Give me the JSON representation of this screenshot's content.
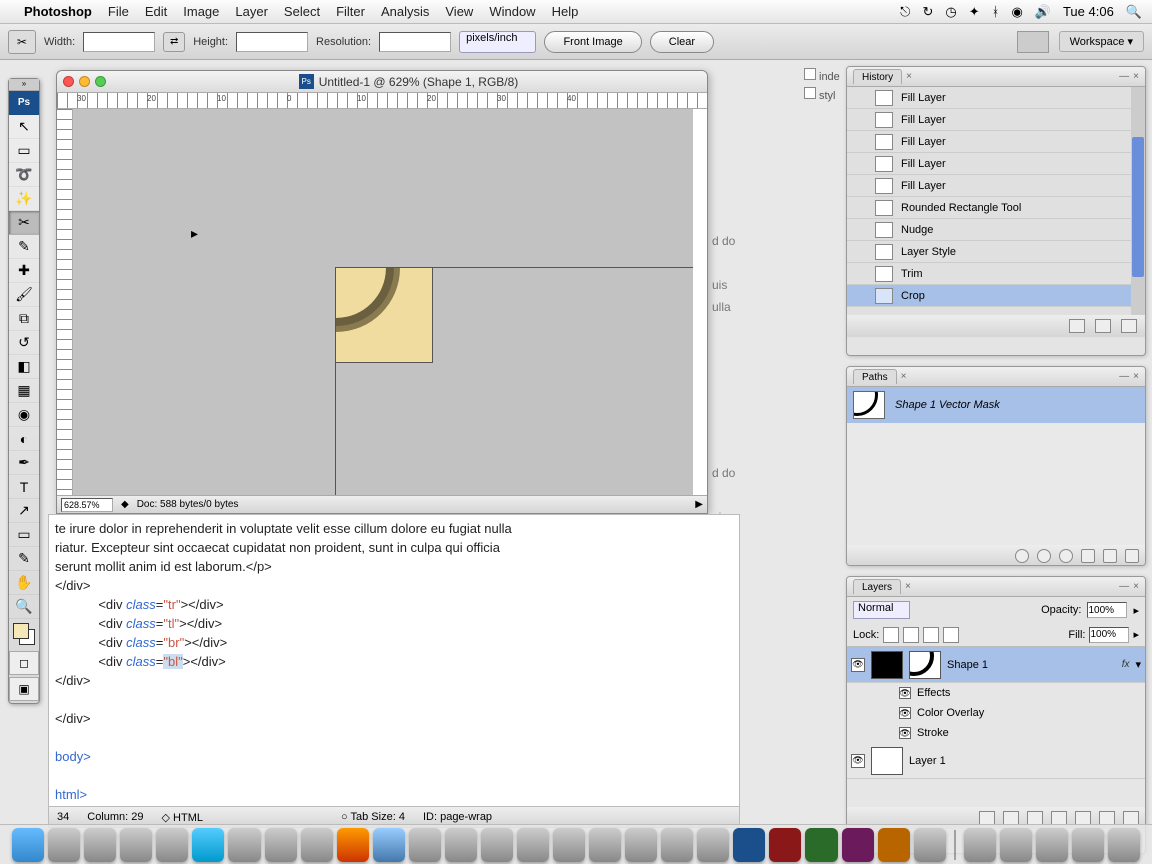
{
  "menubar": {
    "app": "Photoshop",
    "items": [
      "File",
      "Edit",
      "Image",
      "Layer",
      "Select",
      "Filter",
      "Analysis",
      "View",
      "Window",
      "Help"
    ],
    "clock": "Tue 4:06"
  },
  "options": {
    "width_label": "Width:",
    "height_label": "Height:",
    "resolution_label": "Resolution:",
    "unit": "pixels/inch",
    "front_image": "Front Image",
    "clear": "Clear",
    "workspace": "Workspace"
  },
  "document": {
    "title": "Untitled-1 @ 629% (Shape 1, RGB/8)",
    "zoom": "628.57%",
    "docinfo": "Doc: 588 bytes/0 bytes",
    "ruler_marks": [
      "30",
      "20",
      "10",
      "0",
      "10",
      "20",
      "30",
      "40"
    ]
  },
  "code": {
    "lines": [
      "te irure dolor in reprehenderit in voluptate velit esse cillum dolore eu fugiat nulla",
      "riatur. Excepteur sint occaecat cupidatat non proident, sunt in culpa qui officia",
      "serunt mollit anim id est laborum.</p>",
      "            </div>",
      "            <div class=\"tr\"></div>",
      "            <div class=\"tl\"></div>",
      "            <div class=\"br\"></div>",
      "            <div class=\"bl\"></div>",
      "    </div>",
      "",
      "  </div>",
      "",
      "body>",
      "",
      "html>"
    ],
    "status_line": "34",
    "status_col_label": "Column:",
    "status_col": "29",
    "status_lang": "HTML",
    "status_tabsize_label": "Tab Size:",
    "status_tabsize": "4",
    "status_id_label": "ID:",
    "status_id": "page-wrap"
  },
  "files": {
    "a": "inde",
    "b": "styl"
  },
  "underlay": {
    "a": "d do",
    "b": "uis",
    "c": "ulla",
    "a2": "d do",
    "b2": "uis"
  },
  "history": {
    "tab": "History",
    "items": [
      "Fill Layer",
      "Fill Layer",
      "Fill Layer",
      "Fill Layer",
      "Fill Layer",
      "Rounded Rectangle Tool",
      "Nudge",
      "Layer Style",
      "Trim",
      "Crop"
    ]
  },
  "paths": {
    "tab": "Paths",
    "item": "Shape 1 Vector Mask"
  },
  "layers": {
    "tab": "Layers",
    "blend": "Normal",
    "opacity_label": "Opacity:",
    "opacity": "100%",
    "lock_label": "Lock:",
    "fill_label": "Fill:",
    "fill": "100%",
    "layer1_name": "Shape 1",
    "fx": "fx",
    "effects": "Effects",
    "color_overlay": "Color Overlay",
    "stroke": "Stroke",
    "layer2_name": "Layer 1"
  }
}
